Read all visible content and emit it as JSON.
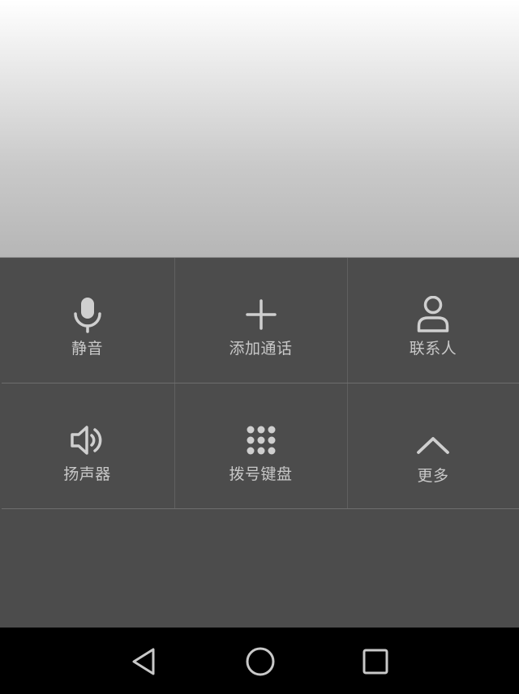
{
  "colors": {
    "panel_background": "#4c4c4c",
    "icon_color": "#cfcfcf",
    "label_color": "#c8c8c8",
    "navbar_background": "#000000",
    "navbar_icon": "#c8c8c8"
  },
  "controls": [
    {
      "id": "mute",
      "label": "静音",
      "icon": "microphone-icon"
    },
    {
      "id": "add_call",
      "label": "添加通话",
      "icon": "plus-icon"
    },
    {
      "id": "contacts",
      "label": "联系人",
      "icon": "person-icon"
    },
    {
      "id": "speaker",
      "label": "扬声器",
      "icon": "speaker-icon"
    },
    {
      "id": "dialpad",
      "label": "拨号键盘",
      "icon": "dialpad-icon"
    },
    {
      "id": "more",
      "label": "更多",
      "icon": "chevron-up-icon"
    }
  ],
  "navbar": {
    "buttons": [
      {
        "id": "back",
        "icon": "back-triangle-icon"
      },
      {
        "id": "home",
        "icon": "home-circle-icon"
      },
      {
        "id": "recents",
        "icon": "recents-square-icon"
      }
    ]
  }
}
